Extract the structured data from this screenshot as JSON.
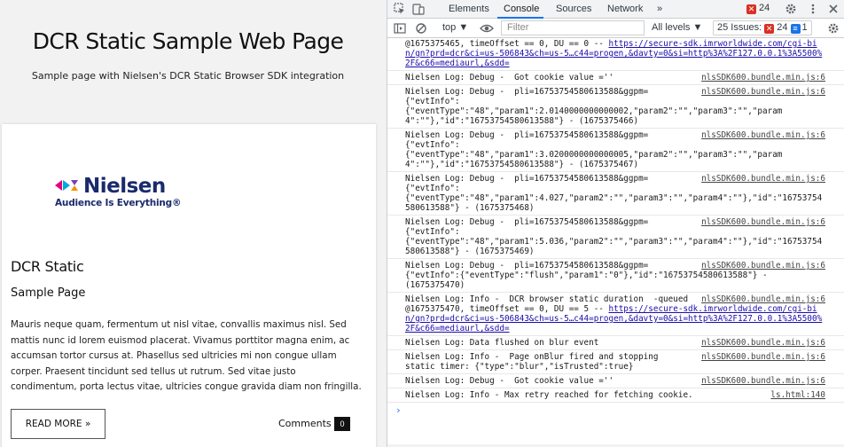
{
  "page": {
    "title": "DCR Static Sample Web Page",
    "subtitle": "Sample page with Nielsen's DCR Static Browser SDK integration",
    "logo": {
      "wordmark": "Nielsen",
      "tagline": "Audience Is Everything®"
    },
    "card_title": "DCR Static",
    "card_subtitle": "Sample Page",
    "card_body": "Mauris neque quam, fermentum ut nisl vitae, convallis maximus nisl. Sed mattis nunc id lorem euismod placerat. Vivamus porttitor magna enim, ac accumsan tortor cursus at. Phasellus sed ultricies mi non congue ullam corper. Praesent tincidunt sed tellus ut rutrum. Sed vitae justo condimentum, porta lectus vitae, ultricies congue gravida diam non fringilla.",
    "read_more_label": "READ MORE »",
    "comments_label": "Comments",
    "comments_count": "0"
  },
  "devtools": {
    "tabs": [
      "Elements",
      "Console",
      "Sources",
      "Network"
    ],
    "active_tab": "Console",
    "more_tabs": "»",
    "error_count": "24",
    "toolbar": {
      "context": "top ▼",
      "filter_placeholder": "Filter",
      "levels": "All levels ▼",
      "issues_label": "25 Issues:",
      "issues_errors": "24",
      "issues_info": "1"
    },
    "console": [
      {
        "pre": "@1675375465, timeOffset == 0, DU == 0 -- ",
        "link": "https://secure-sdk.imrworldwide.com/cgi-bin/gn?prd=dcr&ci=us-506843&ch=us-5…c44=progen,&davty=0&si=http%3A%2F127.0.0.1%3A5500%2F&c66=mediaurl,&sdd=",
        "text": "",
        "src": ""
      },
      {
        "pre": "",
        "link": "",
        "text": "Nielsen Log: Debug -  Got cookie value =''",
        "src": "nlsSDK600.bundle.min.js:6"
      },
      {
        "pre": "",
        "link": "",
        "text": "Nielsen Log: Debug -  pli=16753754580613588&ggpm=\n{\"evtInfo\":\n{\"eventType\":\"48\",\"param1\":2.0140000000000002,\"param2\":\"\",\"param3\":\"\",\"param4\":\"\"},\"id\":\"16753754580613588\"} - (1675375466)",
        "src": "nlsSDK600.bundle.min.js:6"
      },
      {
        "pre": "",
        "link": "",
        "text": "Nielsen Log: Debug -  pli=16753754580613588&ggpm=\n{\"evtInfo\":\n{\"eventType\":\"48\",\"param1\":3.0200000000000005,\"param2\":\"\",\"param3\":\"\",\"param4\":\"\"},\"id\":\"16753754580613588\"} - (1675375467)",
        "src": "nlsSDK600.bundle.min.js:6"
      },
      {
        "pre": "",
        "link": "",
        "text": "Nielsen Log: Debug -  pli=16753754580613588&ggpm=\n{\"evtInfo\":\n{\"eventType\":\"48\",\"param1\":4.027,\"param2\":\"\",\"param3\":\"\",\"param4\":\"\"},\"id\":\"16753754580613588\"} - (1675375468)",
        "src": "nlsSDK600.bundle.min.js:6"
      },
      {
        "pre": "",
        "link": "",
        "text": "Nielsen Log: Debug -  pli=16753754580613588&ggpm=\n{\"evtInfo\":\n{\"eventType\":\"48\",\"param1\":5.036,\"param2\":\"\",\"param3\":\"\",\"param4\":\"\"},\"id\":\"16753754580613588\"} - (1675375469)",
        "src": "nlsSDK600.bundle.min.js:6"
      },
      {
        "pre": "",
        "link": "",
        "text": "Nielsen Log: Debug -  pli=16753754580613588&ggpm=\n{\"evtInfo\":{\"eventType\":\"flush\",\"param1\":\"0\"},\"id\":\"16753754580613588\"} -\n(1675375470)",
        "src": "nlsSDK600.bundle.min.js:6"
      },
      {
        "pre": "Nielsen Log: Info -  DCR browser static duration  -queued\n@1675375470, timeOffset == 0, DU == 5 -- ",
        "link": "https://secure-sdk.imrworldwide.com/cgi-bin/gn?prd=dcr&ci=us-506843&ch=us-5…c44=progen,&davty=0&si=http%3A%2F127.0.0.1%3A5500%2F&c66=mediaurl,&sdd=",
        "text": "",
        "src": "nlsSDK600.bundle.min.js:6"
      },
      {
        "pre": "",
        "link": "",
        "text": "Nielsen Log: Data flushed on blur event",
        "src": "nlsSDK600.bundle.min.js:6"
      },
      {
        "pre": "",
        "link": "",
        "text": "Nielsen Log: Info -  Page onBlur fired and stopping\nstatic timer: {\"type\":\"blur\",\"isTrusted\":true}",
        "src": "nlsSDK600.bundle.min.js:6"
      },
      {
        "pre": "",
        "link": "",
        "text": "Nielsen Log: Debug -  Got cookie value =''",
        "src": "nlsSDK600.bundle.min.js:6"
      },
      {
        "pre": "",
        "link": "",
        "text": "Nielsen Log: Info - Max retry reached for fetching cookie.",
        "src": "ls.html:140"
      }
    ],
    "prompt": "›"
  }
}
